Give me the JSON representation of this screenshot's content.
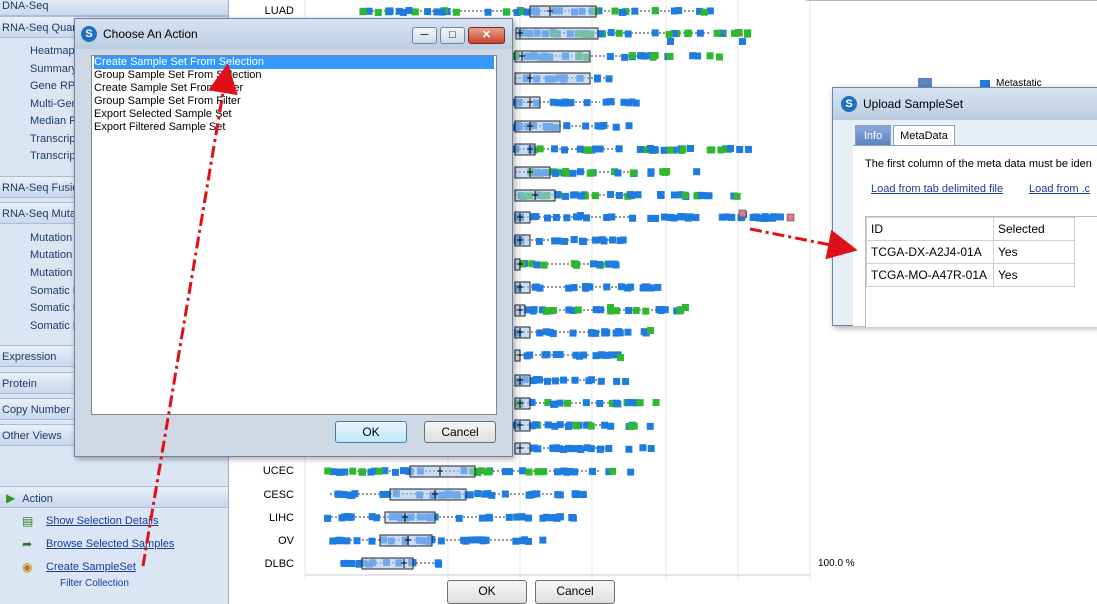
{
  "sidebar": {
    "top_group": "DNA-Seq",
    "rnaseq_quant": "RNA-Seq Quan",
    "quant_items": [
      "Heatmap",
      "Summary",
      "Gene RPK",
      "Multi-Gen",
      "Median R",
      "Transcrip",
      "Transcrip"
    ],
    "rnaseq_fusion": "RNA-Seq Fusio",
    "rnaseq_mutation": "RNA-Seq Mutat",
    "mutation_items": [
      "Mutation",
      "Mutation",
      "Mutation",
      "Somatic M",
      "Somatic M",
      "Somatic M"
    ],
    "groups": [
      "Expression",
      "Protein",
      "Copy Number",
      "Other Views"
    ],
    "action_header": "Action",
    "actions": [
      "Show Selection Details",
      "Browse Selected Samples",
      "Create SampleSet"
    ],
    "partial_action": "Filter Collection"
  },
  "chart": {
    "row_labels": [
      "LUAD",
      "UCEC",
      "CESC",
      "LIHC",
      "OV",
      "DLBC"
    ],
    "percent_label": "100.0 %",
    "legend_label": "Metastatic",
    "bottom_ok": "OK",
    "bottom_cancel": "Cancel"
  },
  "choose_action": {
    "title": "Choose An Action",
    "items": [
      "Create Sample Set From Selection",
      "Group Sample Set From Selection",
      "Create Sample Set From Filter",
      "Group Sample Set From Filter",
      "Export Selected Sample Set",
      "Export Filtered Sample Set"
    ],
    "ok": "OK",
    "cancel": "Cancel"
  },
  "upload": {
    "title": "Upload SampleSet",
    "tabs": [
      "Info",
      "MetaData"
    ],
    "instruction": "The first column of the meta data must be iden",
    "link_tab": "Load from tab delimited file",
    "link_other": "Load from .c",
    "headers": [
      "ID",
      "Selected"
    ],
    "rows": [
      {
        "id": "TCGA-DX-A2J4-01A",
        "selected": "Yes"
      },
      {
        "id": "TCGA-MO-A47R-01A",
        "selected": "Yes"
      }
    ]
  },
  "colors": {
    "accent": "#3399ff",
    "marker_blue": "#1e7be0",
    "marker_green": "#2fb82f",
    "annotation_red": "#e0101a"
  }
}
